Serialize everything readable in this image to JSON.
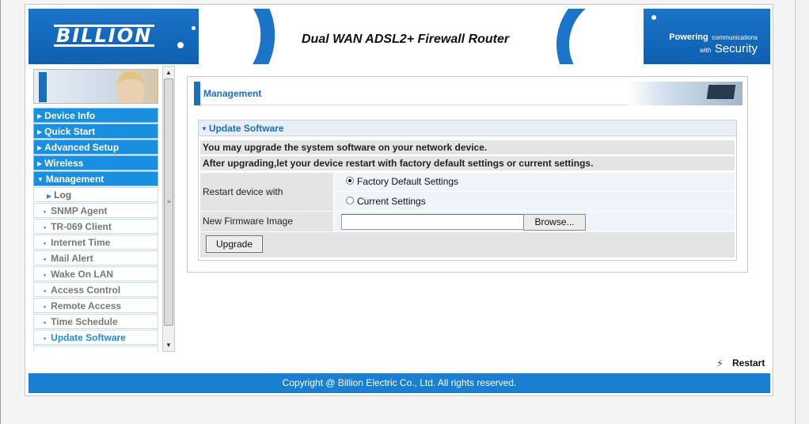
{
  "header": {
    "logo": "BILLION",
    "title": "Dual WAN ADSL2+ Firewall Router",
    "tagline_line1": "Powering",
    "tagline_line2": "communications",
    "tagline_line3": "with",
    "tagline_line4": "Security"
  },
  "sidebar": {
    "items": [
      {
        "label": "Device Info",
        "arrow": "▶"
      },
      {
        "label": "Quick Start",
        "arrow": "▶"
      },
      {
        "label": "Advanced Setup",
        "arrow": "▶"
      },
      {
        "label": "Wireless",
        "arrow": "▶"
      },
      {
        "label": "Management",
        "arrow": "▼"
      }
    ],
    "subitems": [
      {
        "label": "Log",
        "bullet": "▶"
      },
      {
        "label": "SNMP Agent",
        "bullet": "•"
      },
      {
        "label": "TR-069 Client",
        "bullet": "•"
      },
      {
        "label": "Internet Time",
        "bullet": "•"
      },
      {
        "label": "Mail Alert",
        "bullet": "•"
      },
      {
        "label": "Wake On LAN",
        "bullet": "•"
      },
      {
        "label": "Access Control",
        "bullet": "•"
      },
      {
        "label": "Remote Access",
        "bullet": "•"
      },
      {
        "label": "Time Schedule",
        "bullet": "•"
      },
      {
        "label": "Update Software",
        "bullet": "•"
      }
    ],
    "scroll_up": "▲",
    "scroll_down": "▼",
    "scroll_grip": "≡"
  },
  "main": {
    "section_title": "Management",
    "panel_title": "Update Software",
    "panel_arrow": "▼",
    "info1": "You may upgrade the system software on your network device.",
    "info2": "After upgrading,let your device restart with factory default settings or current settings.",
    "restart_label": "Restart device with",
    "option1": "Factory Default Settings",
    "option2": "Current Settings",
    "firmware_label": "New Firmware Image",
    "browse_label": "Browse...",
    "upgrade_label": "Upgrade"
  },
  "restart": {
    "label": "Restart",
    "icon": "⚡"
  },
  "footer": {
    "copyright": "Copyright @ Billion Electric Co., Ltd. All rights reserved."
  },
  "colors": {
    "accent": "#1a8fe0",
    "brand": "#1a6fc0",
    "footer": "#1a7fd0"
  }
}
